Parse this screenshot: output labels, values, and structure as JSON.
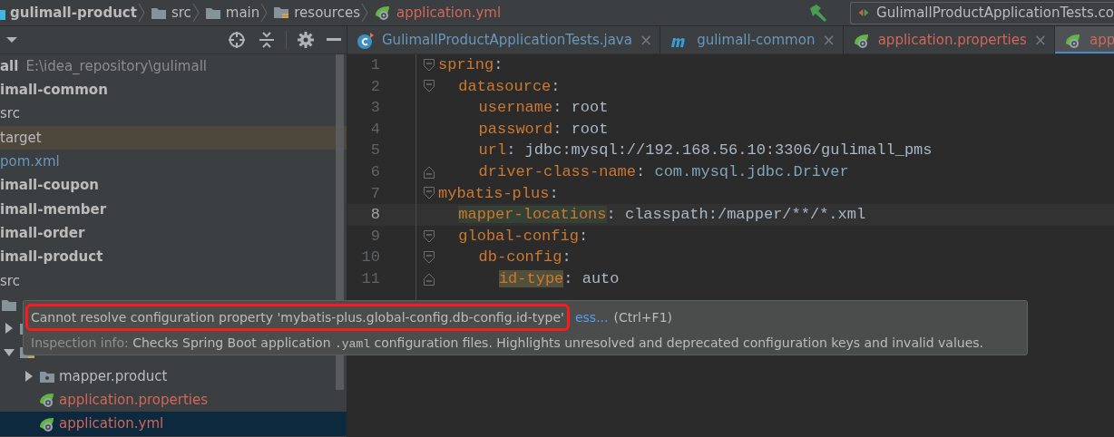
{
  "breadcrumbs": [
    {
      "label": "gulimall-product",
      "kind": "module",
      "color": "#bbbbbb"
    },
    {
      "label": "src",
      "kind": "folder",
      "color": "#bbbbbb"
    },
    {
      "label": "main",
      "kind": "folder",
      "color": "#bbbbbb"
    },
    {
      "label": "resources",
      "kind": "resources",
      "color": "#bbbbbb"
    },
    {
      "label": "application.yml",
      "kind": "spring",
      "color": "#d1675a"
    }
  ],
  "run_config": {
    "label": "GulimallProductApplicationTests.co"
  },
  "tabs": [
    {
      "label": "GulimallProductApplicationTests.java",
      "kind": "java",
      "color": "#6897bb",
      "selected": false,
      "close": "×"
    },
    {
      "label": "gulimall-common",
      "kind": "maven",
      "color": "#6897bb",
      "selected": false,
      "close": "×"
    },
    {
      "label": "application.properties",
      "kind": "spring",
      "color": "#d1675a",
      "selected": false,
      "close": "×"
    },
    {
      "label": "app",
      "kind": "spring",
      "color": "#d1675a",
      "selected": true
    }
  ],
  "tree": [
    {
      "label": "all",
      "path": "E:\\idea_repository\\gulimall",
      "kind": "module",
      "children": [
        {
          "label": "imall-common",
          "kind": "module",
          "children": [
            {
              "label": "src",
              "color": "#bbbbbb",
              "excluded": false
            },
            {
              "label": "target",
              "color": "#bbbbbb",
              "excluded": true
            },
            {
              "label": "pom.xml",
              "color": "#6897bb",
              "excluded": false
            }
          ]
        },
        {
          "label": "imall-coupon",
          "kind": "module"
        },
        {
          "label": "imall-member",
          "kind": "module"
        },
        {
          "label": "imall-order",
          "kind": "module"
        },
        {
          "label": "imall-product",
          "kind": "module",
          "children": [
            {
              "label": "src",
              "color": "#bbbbbb",
              "children": [
                {
                  "kind": "folder",
                  "children": [
                    {
                      "kind": "package",
                      "expanded": false
                    },
                    {
                      "kind": "resources",
                      "expanded": true,
                      "children": [
                        {
                          "label": "mapper.product",
                          "kind": "package",
                          "color": "#bbbbbb",
                          "expanded": false
                        },
                        {
                          "label": "application.properties",
                          "kind": "spring",
                          "color": "#d1675a",
                          "selected": false
                        },
                        {
                          "label": "application.yml",
                          "kind": "spring",
                          "color": "#d1675a",
                          "selected": true
                        }
                      ]
                    }
                  ]
                }
              ]
            }
          ]
        }
      ]
    }
  ],
  "editor": {
    "lines": [
      {
        "number": "1",
        "key": "spring",
        "separator": ":",
        "usage_highlight": false,
        "warning": false,
        "current": false,
        "children": [
          {
            "number": "2",
            "key": "datasource",
            "separator": ":",
            "usage_highlight": false,
            "warning": false,
            "current": false,
            "children": [
              {
                "number": "3",
                "key": "username",
                "separator": ":",
                "value": "root",
                "type_reference": false,
                "usage_highlight": false,
                "warning": false,
                "current": false
              },
              {
                "number": "4",
                "key": "password",
                "separator": ":",
                "value": "root",
                "type_reference": false,
                "usage_highlight": false,
                "warning": false,
                "current": false
              },
              {
                "number": "5",
                "key": "url",
                "separator": ":",
                "value": "jdbc:mysql://192.168.56.10:3306/gulimall_pms",
                "type_reference": false,
                "usage_highlight": false,
                "warning": false,
                "current": false
              },
              {
                "number": "6",
                "key": "driver-class-name",
                "separator": ":",
                "value": "com.mysql.jdbc.Driver",
                "type_reference": true,
                "usage_highlight": false,
                "warning": false,
                "current": false
              }
            ]
          }
        ]
      },
      {
        "number": "7",
        "key": "mybatis-plus",
        "separator": ":",
        "usage_highlight": false,
        "warning": false,
        "current": false,
        "children": [
          {
            "number": "8",
            "key": "mapper-locations",
            "separator": ":",
            "value": "classpath:/mapper/**/*.xml",
            "type_reference": false,
            "usage_highlight": true,
            "warning": false,
            "current": true
          },
          {
            "number": "9",
            "key": "global-config",
            "separator": ":",
            "usage_highlight": false,
            "warning": false,
            "current": false,
            "children": [
              {
                "number": "10",
                "key": "db-config",
                "separator": ":",
                "usage_highlight": false,
                "warning": false,
                "current": false,
                "children": [
                  {
                    "number": "11",
                    "key": "id-type",
                    "separator": ":",
                    "value": "auto",
                    "type_reference": false,
                    "usage_highlight": false,
                    "warning": true,
                    "current": false
                  }
                ]
              }
            ]
          }
        ]
      }
    ]
  },
  "tooltip": {
    "message": "Cannot resolve configuration property 'mybatis-plus.global-config.db-config.id-type'",
    "link": "ess...",
    "shortcut": "(Ctrl+F1)",
    "info_label": "Inspection info:",
    "info_before": "Checks Spring Boot application",
    "info_code": ".yaml",
    "info_after": "configuration files. Highlights unresolved and deprecated configuration keys and invalid values.",
    "highlighted": true
  }
}
